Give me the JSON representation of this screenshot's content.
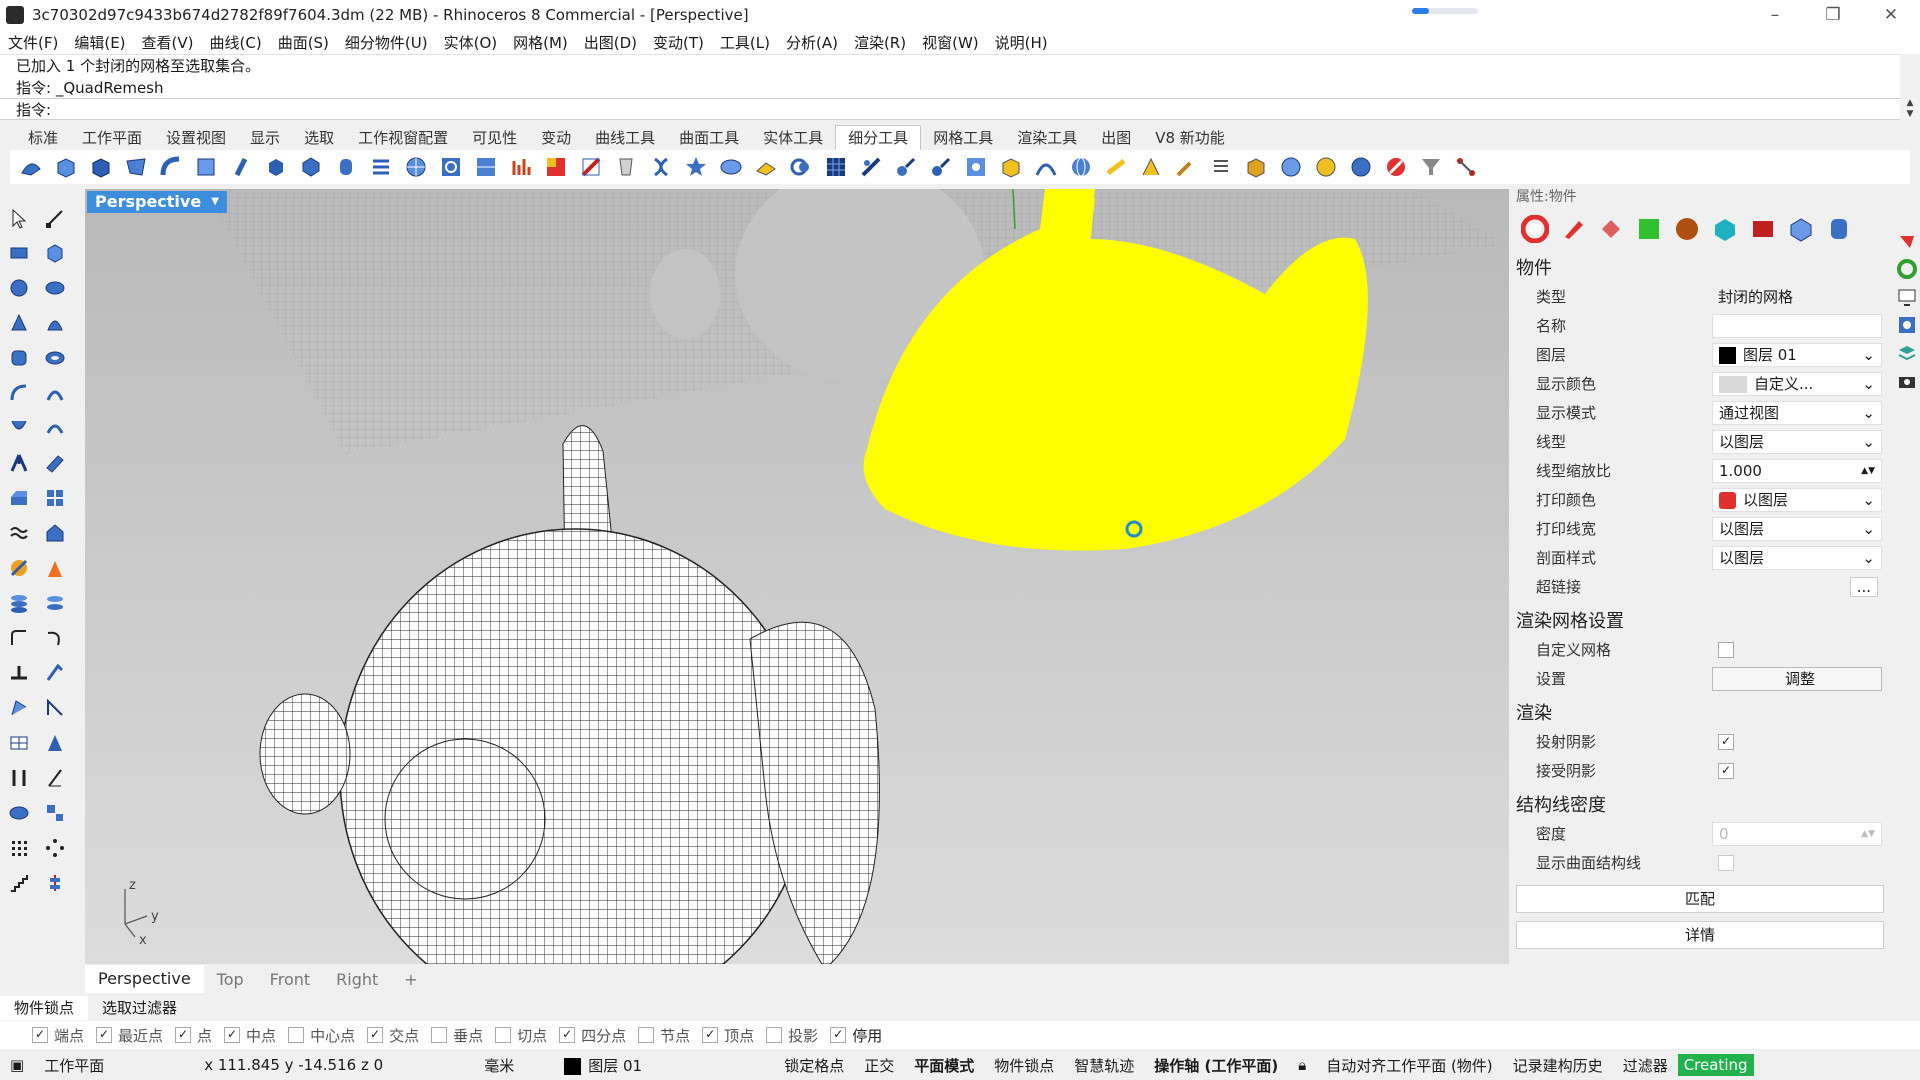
{
  "window": {
    "title": "3c70302d97c9433b674d2782f89f7604.3dm (22 MB) - Rhinoceros 8 Commercial - [Perspective]",
    "progress": 0.25
  },
  "menu": [
    "文件(F)",
    "编辑(E)",
    "查看(V)",
    "曲线(C)",
    "曲面(S)",
    "细分物件(U)",
    "实体(O)",
    "网格(M)",
    "出图(D)",
    "变动(T)",
    "工具(L)",
    "分析(A)",
    "渲染(R)",
    "视窗(W)",
    "说明(H)"
  ],
  "command": {
    "history": [
      "已加入 1 个封闭的网格至选取集合。",
      "指令: _QuadRemesh"
    ],
    "prompt": "指令:"
  },
  "toolbar_tabs": [
    "标准",
    "工作平面",
    "设置视图",
    "显示",
    "选取",
    "工作视窗配置",
    "可见性",
    "变动",
    "曲线工具",
    "曲面工具",
    "实体工具",
    "细分工具",
    "网格工具",
    "渲染工具",
    "出图",
    "V8 新功能"
  ],
  "active_toolbar_tab": "细分工具",
  "viewport": {
    "title": "Perspective",
    "tabs": [
      "Perspective",
      "Top",
      "Front",
      "Right"
    ],
    "axes": {
      "z": "z",
      "y": "y",
      "x": "x"
    }
  },
  "properties": {
    "header": "属性:物件",
    "sections": {
      "object": "物件",
      "render_mesh": "渲染网格设置",
      "render": "渲染",
      "isocurve": "结构线密度"
    },
    "type_label": "类型",
    "type_value": "封闭的网格",
    "name_label": "名称",
    "layer_label": "图层",
    "layer_value": "图层 01",
    "display_color_label": "显示颜色",
    "display_color_value": "自定义...",
    "display_mode_label": "显示模式",
    "display_mode_value": "通过视图",
    "linetype_label": "线型",
    "linetype_value": "以图层",
    "linetype_scale_label": "线型缩放比",
    "linetype_scale_value": "1.000",
    "print_color_label": "打印颜色",
    "print_color_value": "以图层",
    "print_width_label": "打印线宽",
    "print_width_value": "以图层",
    "section_style_label": "剖面样式",
    "section_style_value": "以图层",
    "hyperlink_label": "超链接",
    "hyperlink_button": "...",
    "custom_mesh_label": "自定义网格",
    "settings_label": "设置",
    "adjust_button": "调整",
    "cast_shadow_label": "投射阴影",
    "receive_shadow_label": "接受阴影",
    "density_label": "密度",
    "density_value": "0",
    "show_isocurves_label": "显示曲面结构线",
    "match_button": "匹配",
    "details_button": "详情"
  },
  "osnap_tabs": [
    "物件锁点",
    "选取过滤器"
  ],
  "osnaps": [
    {
      "label": "端点",
      "checked": true
    },
    {
      "label": "最近点",
      "checked": true
    },
    {
      "label": "点",
      "checked": true
    },
    {
      "label": "中点",
      "checked": true
    },
    {
      "label": "中心点",
      "checked": false
    },
    {
      "label": "交点",
      "checked": true
    },
    {
      "label": "垂点",
      "checked": false
    },
    {
      "label": "切点",
      "checked": false
    },
    {
      "label": "四分点",
      "checked": true
    },
    {
      "label": "节点",
      "checked": false
    },
    {
      "label": "顶点",
      "checked": true
    },
    {
      "label": "投影",
      "checked": false
    },
    {
      "label": "停用",
      "checked": true
    }
  ],
  "status": {
    "cplane": "工作平面",
    "coords": "x 111.845  y -14.516  z 0",
    "units": "毫米",
    "layer": "图层 01",
    "grid_snap": "锁定格点",
    "ortho": "正交",
    "planar": "平面模式",
    "osnap": "物件锁点",
    "smarttrack": "智慧轨迹",
    "gumball": "操作轴 (工作平面)",
    "autoalign": "自动对齐工作平面 (物件)",
    "history": "记录建构历史",
    "filter": "过滤器",
    "state": "Creating"
  },
  "colors": {
    "accent": "#3d8fde",
    "selection": "#ffff00",
    "creating": "#22b14c"
  }
}
